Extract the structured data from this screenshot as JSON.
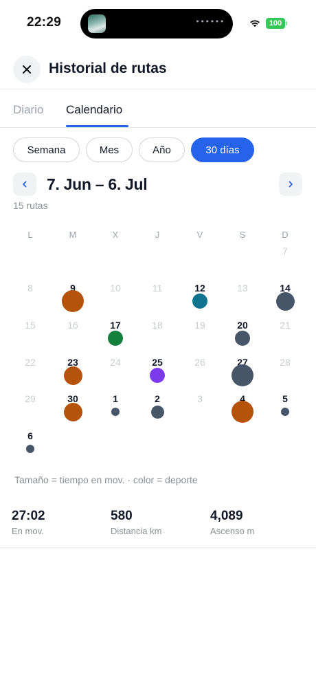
{
  "status_bar": {
    "time": "22:29",
    "battery": "100",
    "island_text": "••••••"
  },
  "header": {
    "title": "Historial de rutas"
  },
  "tabs": [
    {
      "label": "Diario",
      "active": false
    },
    {
      "label": "Calendario",
      "active": true
    }
  ],
  "periods": [
    {
      "label": "Semana",
      "active": false
    },
    {
      "label": "Mes",
      "active": false
    },
    {
      "label": "Año",
      "active": false
    },
    {
      "label": "30 días",
      "active": true
    }
  ],
  "range": {
    "prev_icon": "‹",
    "next_icon": "›",
    "title": "7. Jun – 6. Jul",
    "count": "15 rutas"
  },
  "calendar": {
    "weekdays": [
      "L",
      "M",
      "X",
      "J",
      "V",
      "S",
      "D"
    ],
    "cells": [
      {
        "day": "7",
        "active": false
      },
      {
        "day": "8",
        "active": false
      },
      {
        "day": "9",
        "active": true,
        "sport": "orange",
        "size": "large"
      },
      {
        "day": "10",
        "active": false
      },
      {
        "day": "11",
        "active": false
      },
      {
        "day": "12",
        "active": true,
        "sport": "teal",
        "size": "small"
      },
      {
        "day": "13",
        "active": false
      },
      {
        "day": "14",
        "active": true,
        "sport": "slate",
        "size": "medium"
      },
      {
        "day": "15",
        "active": false
      },
      {
        "day": "16",
        "active": false
      },
      {
        "day": "17",
        "active": true,
        "sport": "green",
        "size": "small"
      },
      {
        "day": "18",
        "active": false
      },
      {
        "day": "19",
        "active": false
      },
      {
        "day": "20",
        "active": true,
        "sport": "slate",
        "size": "small"
      },
      {
        "day": "21",
        "active": false
      },
      {
        "day": "22",
        "active": false
      },
      {
        "day": "23",
        "active": true,
        "sport": "orange",
        "size": "medium"
      },
      {
        "day": "24",
        "active": false
      },
      {
        "day": "25",
        "active": true,
        "sport": "purple",
        "size": "small"
      },
      {
        "day": "26",
        "active": false
      },
      {
        "day": "27",
        "active": true,
        "sport": "slate",
        "size": "large"
      },
      {
        "day": "28",
        "active": false
      },
      {
        "day": "29",
        "active": false
      },
      {
        "day": "30",
        "active": true,
        "sport": "orange",
        "size": "medium"
      },
      {
        "day": "1",
        "active": true,
        "sport": "slate",
        "size": "tiny"
      },
      {
        "day": "2",
        "active": true,
        "sport": "slate",
        "size": "xsmall"
      },
      {
        "day": "3",
        "active": false
      },
      {
        "day": "4",
        "active": true,
        "sport": "orange",
        "size": "large"
      },
      {
        "day": "5",
        "active": true,
        "sport": "slate",
        "size": "tiny"
      },
      {
        "day": "6",
        "active": true,
        "sport": "slate",
        "size": "tiny"
      }
    ]
  },
  "sport_colors": {
    "orange": "#b45309",
    "teal": "#0e7490",
    "slate": "#475569",
    "green": "#15803d",
    "purple": "#7c3aed"
  },
  "legend": "Tamaño = tiempo en mov. · color = deporte",
  "stats": [
    {
      "value": "27:02",
      "label": "En mov."
    },
    {
      "value": "580",
      "label": "Distancia km"
    },
    {
      "value": "4,089",
      "label": "Ascenso m"
    }
  ],
  "colors": {
    "accent": "#2563eb"
  }
}
